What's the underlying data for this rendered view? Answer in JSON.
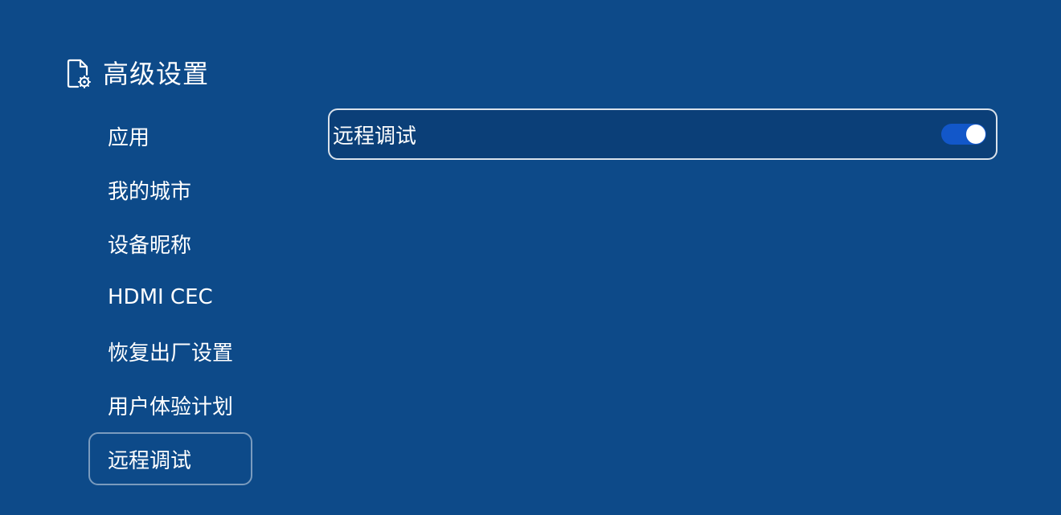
{
  "header": {
    "title": "高级设置",
    "icon": "settings-document-icon"
  },
  "sidebar": {
    "items": [
      {
        "label": "应用"
      },
      {
        "label": "我的城市"
      },
      {
        "label": "设备昵称"
      },
      {
        "label": "HDMI CEC"
      },
      {
        "label": "恢复出厂设置"
      },
      {
        "label": "用户体验计划"
      },
      {
        "label": "远程调试",
        "selected": true
      }
    ]
  },
  "content": {
    "rows": [
      {
        "label": "远程调试",
        "toggle_on": true
      }
    ]
  },
  "colors": {
    "background": "#0d4a89",
    "row_background": "#0b3f78",
    "toggle_on": "#1257c9",
    "text": "#ffffff"
  }
}
